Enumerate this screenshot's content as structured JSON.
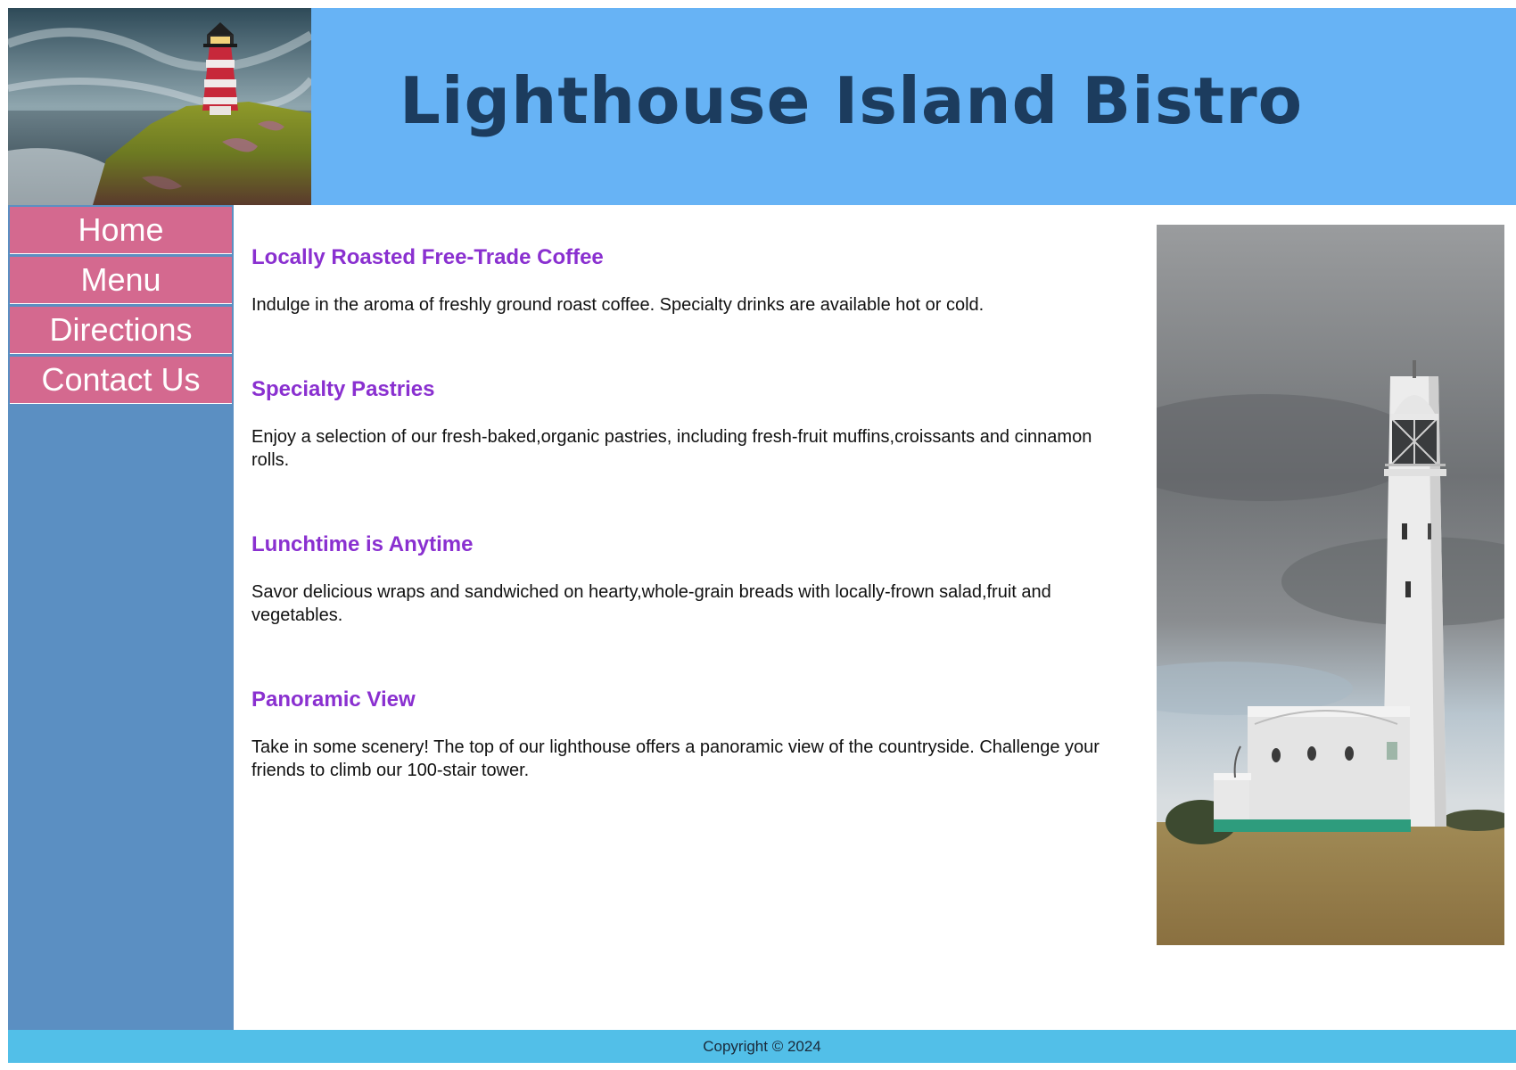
{
  "header": {
    "title": "Lighthouse Island Bistro",
    "logo_image": "lighthouse-on-cliff"
  },
  "nav": {
    "items": [
      {
        "label": "Home"
      },
      {
        "label": "Menu"
      },
      {
        "label": "Directions"
      },
      {
        "label": "Contact Us"
      }
    ]
  },
  "main": {
    "sections": [
      {
        "heading": "Locally Roasted Free-Trade Coffee",
        "text": "Indulge in the aroma of freshly ground roast coffee. Specialty drinks are available hot or cold."
      },
      {
        "heading": "Specialty Pastries",
        "text": "Enjoy a selection of our fresh-baked,organic pastries, including fresh-fruit muffins,croissants and cinnamon rolls."
      },
      {
        "heading": "Lunchtime is Anytime",
        "text": "Savor delicious wraps and sandwiched on hearty,whole-grain breads with locally-frown salad,fruit and vegetables."
      },
      {
        "heading": "Panoramic View",
        "text": "Take in some scenery! The top of our lighthouse offers a panoramic view of the countryside. Challenge your friends to climb our 100-stair tower."
      }
    ]
  },
  "side_image": "white-lighthouse",
  "footer": {
    "copyright": "Copyright © 2024"
  },
  "colors": {
    "header_bg": "#67b3f5",
    "title": "#1c3c5e",
    "nav_bg": "#5b8fc2",
    "nav_item": "#d4698f",
    "heading": "#8a30d0",
    "footer_bg": "#52bfe8"
  }
}
